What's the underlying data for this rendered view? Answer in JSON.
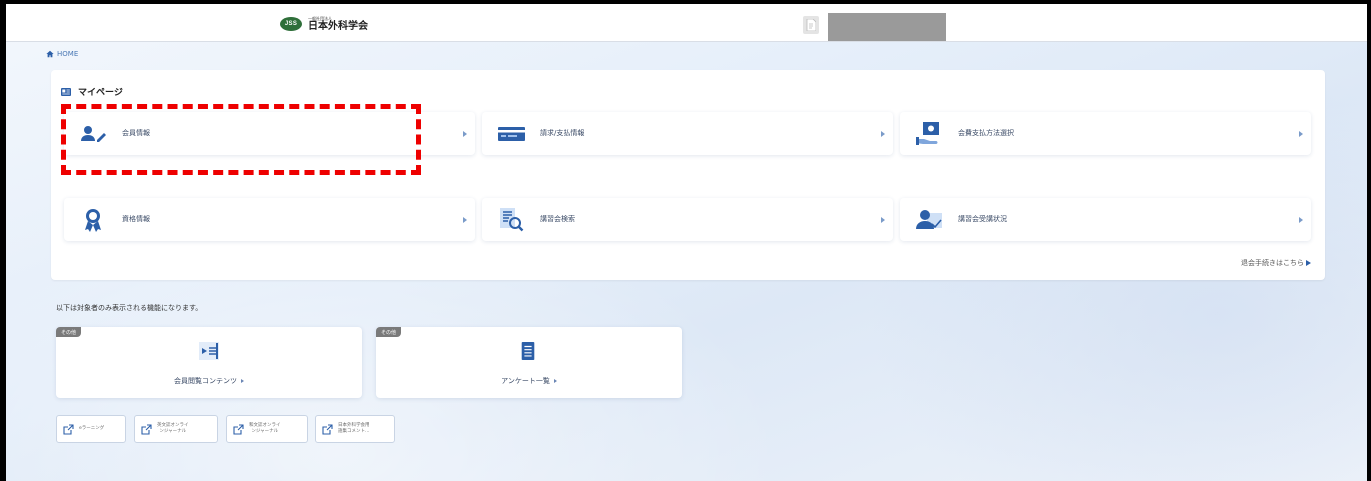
{
  "header": {
    "logo_badge": "JSS",
    "logo_subtitle": "一般社団法人",
    "logo_title": "日本外科学会"
  },
  "breadcrumb": {
    "home_label": "HOME"
  },
  "mypage": {
    "title": "マイページ",
    "cards": [
      {
        "label": "会員情報",
        "icon": "member-edit-icon"
      },
      {
        "label": "請求/支払情報",
        "icon": "credit-card-icon"
      },
      {
        "label": "会費支払方法選択",
        "icon": "payment-hand-icon"
      },
      {
        "label": "資格情報",
        "icon": "award-ribbon-icon"
      },
      {
        "label": "講習会検索",
        "icon": "document-search-icon"
      },
      {
        "label": "講習会受講状況",
        "icon": "attendee-check-icon"
      }
    ],
    "withdraw_link": "退会手続きはこちら"
  },
  "notice": "以下は対象者のみ表示される機能になります。",
  "sub_cards": [
    {
      "badge": "その他",
      "label": "会員閲覧コンテンツ",
      "icon": "video-list-icon"
    },
    {
      "badge": "その他",
      "label": "アンケート一覧",
      "icon": "survey-list-icon"
    }
  ],
  "external_links": [
    {
      "label": "eラーニング"
    },
    {
      "label": "英文誌オンライ\nンジャーナル"
    },
    {
      "label": "和文誌オンライ\nンジャーナル"
    },
    {
      "label": "日本外科学会用\n語集コメント…"
    }
  ],
  "colors": {
    "accent": "#2c5fa8",
    "highlight": "#e00000",
    "badge": "#7a7a7a"
  }
}
